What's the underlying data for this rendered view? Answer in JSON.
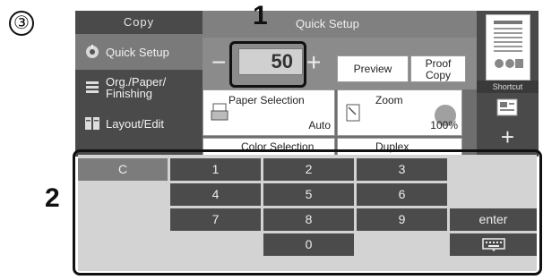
{
  "step_badge": "③",
  "callouts": {
    "one": "1",
    "two": "2"
  },
  "nav": {
    "title": "Copy",
    "items": [
      {
        "label": "Quick Setup",
        "icon": "quick-setup-icon",
        "active": true
      },
      {
        "label": "Org./Paper/\nFinishing",
        "icon": "org-paper-icon",
        "active": false
      },
      {
        "label": "Layout/Edit",
        "icon": "layout-edit-icon",
        "active": false
      }
    ]
  },
  "header": {
    "title": "Quick Setup"
  },
  "copies": {
    "minus": "−",
    "value": "50",
    "plus": "+"
  },
  "actions": {
    "preview": "Preview",
    "proof_copy": "Proof\nCopy"
  },
  "tiles": {
    "paper_selection": {
      "label": "Paper Selection",
      "value": "Auto"
    },
    "zoom": {
      "label": "Zoom",
      "value": "100%"
    },
    "color_selection": {
      "label": "Color Selection"
    },
    "duplex": {
      "label": "Duplex"
    }
  },
  "right_panel": {
    "shortcut": "Shortcut",
    "add": "+"
  },
  "keypad": {
    "clear": "C",
    "digits": [
      "1",
      "2",
      "3",
      "4",
      "5",
      "6",
      "7",
      "8",
      "9",
      "0"
    ],
    "enter": "enter"
  },
  "colors": {
    "screen_bg": "#6e6e6e",
    "nav_bg": "#4a4a4a",
    "key_bg": "#4b4b4b",
    "keypad_bg": "#d3d3d3"
  }
}
